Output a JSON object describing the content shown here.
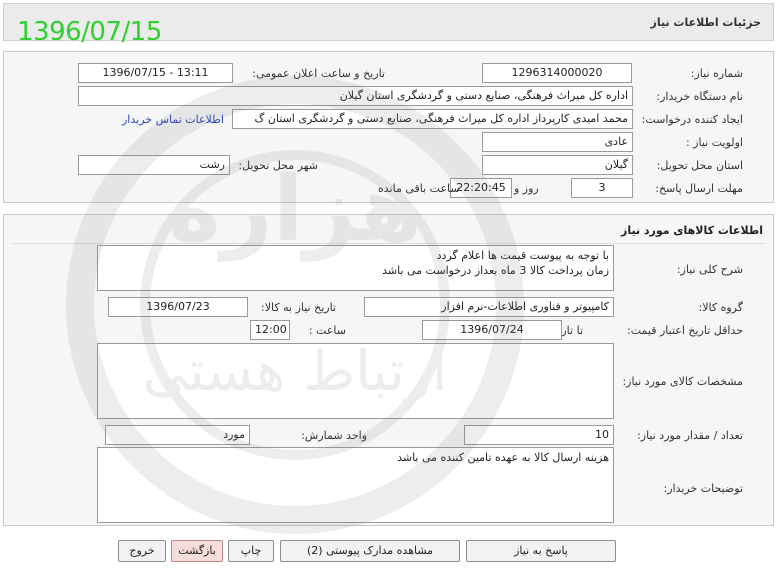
{
  "header": {
    "title": "جزئیات اطلاعات نیاز",
    "date_stamp": "1396/07/15"
  },
  "general": {
    "need_number_label": "شماره نیاز:",
    "need_number": "1296314000020",
    "announce_label": "تاریخ و ساعت اعلان عمومی:",
    "announce_value": "1396/07/15 - 13:11",
    "buyer_label": "نام دستگاه خریدار:",
    "buyer_value": "اداره کل میراث فرهنگی، صنایع دستی و گردشگری استان گیلان",
    "creator_label": "ایجاد کننده درخواست:",
    "creator_value": "محمد امیدی کارپرداز اداره کل میراث فرهنگی، صنایع دستی و گردشگری استان گ",
    "contact_link": "اطلاعات تماس خریدار",
    "priority_label": "اولویت نیاز :",
    "priority_value": "عادی",
    "province_label": "استان محل تحویل:",
    "province_value": "گیلان",
    "city_label": "شهر محل تحویل:",
    "city_value": "رشت",
    "deadline_label": "مهلت ارسال پاسخ:",
    "days_value": "3",
    "days_unit": "روز و",
    "time_value": "22:20:45",
    "remaining_label": "ساعت باقی مانده"
  },
  "goods": {
    "section_title": "اطلاعات کالاهای مورد نیاز",
    "summary_label": "شرح کلی نیاز:",
    "summary_line1": "با توجه به پیوست قیمت ها اعلام گردد",
    "summary_line2": "زمان پرداخت کالا 3 ماه بعداز درخواست می باشد",
    "group_label": "گروه کالا:",
    "group_value": "کامپیوتر و فناوری اطلاعات-نرم افزار",
    "need_date_label": "تاریخ نیاز به کالا:",
    "need_date_value": "1396/07/23",
    "validity_label": "حداقل تاریخ اعتبار قیمت:",
    "until_label": "تا تاریخ :",
    "until_value": "1396/07/24",
    "hour_label": "ساعت :",
    "hour_value": "12:00",
    "specs_label": "مشخصات کالای مورد نیاز:",
    "specs_value": "",
    "qty_label": "تعداد / مقدار مورد نیاز:",
    "qty_value": "10",
    "unit_label": "واحد شمارش:",
    "unit_value": "مورد",
    "notes_label": "توضیحات خریدار:",
    "notes_value": "هزینه ارسال کالا به عهده تامین کننده می باشد"
  },
  "buttons": {
    "reply": "پاسخ به نیاز",
    "attachments": "مشاهده مدارک پیوستی (2)",
    "print": "چاپ",
    "back": "بازگشت",
    "exit": "خروج"
  },
  "watermark": {
    "text_main": "هزاره",
    "text_small": "ارتباط هستی"
  }
}
